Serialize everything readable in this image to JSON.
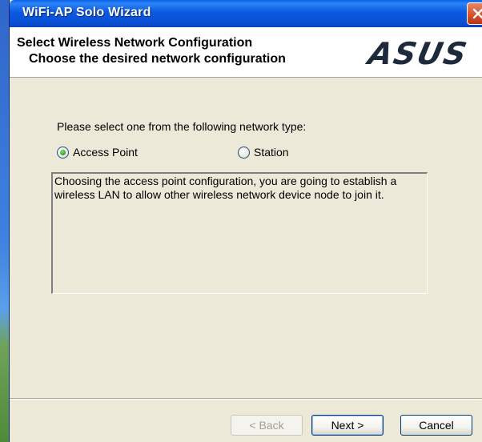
{
  "window": {
    "title": "WiFi-AP Solo Wizard"
  },
  "header": {
    "title": "Select Wireless Network Configuration",
    "subtitle": "Choose the desired network configuration",
    "logo_text": "ASUS"
  },
  "main": {
    "prompt": "Please select one from the following network type:",
    "options": [
      {
        "label": "Access Point",
        "checked": true
      },
      {
        "label": "Station",
        "checked": false
      }
    ],
    "description": "Choosing the access point configuration, you are going to establish a wireless LAN to allow other wireless network device node to join it."
  },
  "footer": {
    "back_label": "< Back",
    "next_label": "Next >",
    "cancel_label": "Cancel"
  },
  "colors": {
    "titlebar": "#0a5fe8",
    "dialog_bg": "#ece9d8",
    "radio_selected": "#21a121",
    "close_button": "#d2502a"
  }
}
